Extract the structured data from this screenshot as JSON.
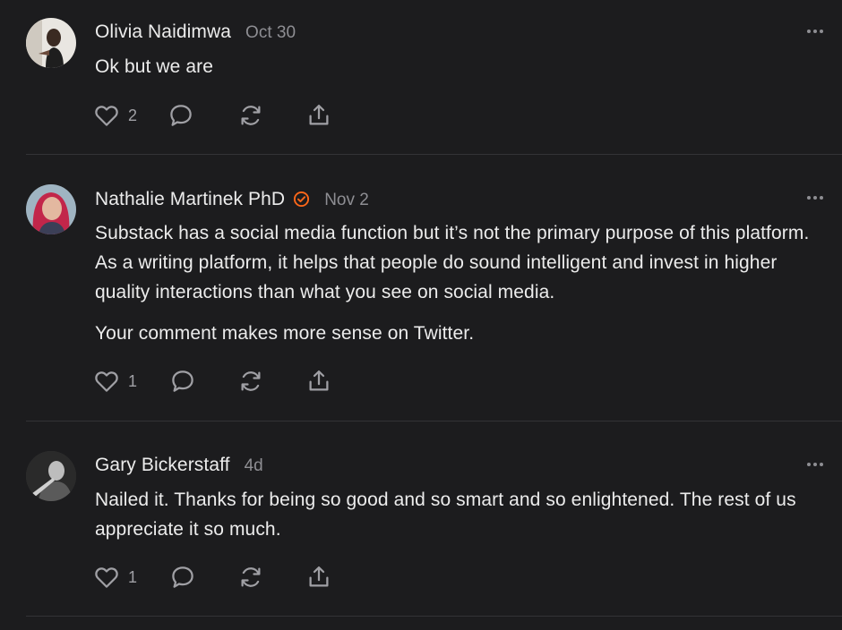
{
  "comments": [
    {
      "author": "Olivia Naidimwa",
      "date": "Oct 30",
      "verified": false,
      "paragraphs": [
        "Ok but we are"
      ],
      "likes": "2",
      "avatar_icon": "avatar-photo"
    },
    {
      "author": "Nathalie Martinek PhD",
      "date": "Nov 2",
      "verified": true,
      "paragraphs": [
        "Substack has a social media function but it’s not the primary purpose of this platform. As a writing platform, it helps that people do sound intelligent and invest in higher quality interactions than what you see on social media.",
        "Your comment makes more sense on Twitter."
      ],
      "likes": "1",
      "avatar_icon": "avatar-photo"
    },
    {
      "author": "Gary Bickerstaff",
      "date": "4d",
      "verified": false,
      "paragraphs": [
        "Nailed it. Thanks for being so good and so smart and so enlightened. The rest of us appreciate it so much."
      ],
      "likes": "1",
      "avatar_icon": "avatar-photo"
    }
  ],
  "icons": {
    "like": "heart-icon",
    "reply": "comment-bubble-icon",
    "restack": "restack-icon",
    "share": "share-icon",
    "more": "more-dots-icon",
    "verified": "verified-check-icon"
  },
  "colors": {
    "background": "#1c1c1e",
    "text": "#ececec",
    "muted": "#8e8e93",
    "verified_accent": "#ff6719",
    "icon": "#a0a0a5"
  }
}
